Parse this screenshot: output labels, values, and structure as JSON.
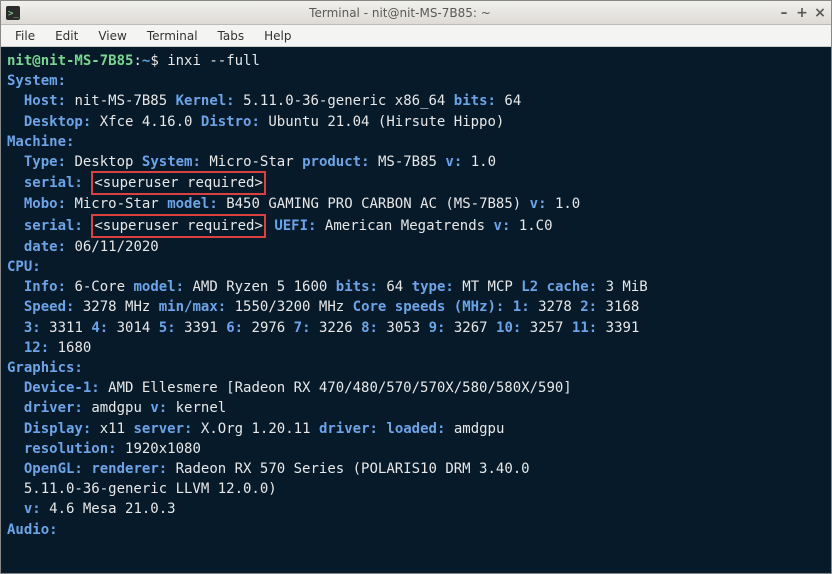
{
  "window": {
    "title": "Terminal - nit@nit-MS-7B85: ~"
  },
  "menubar": {
    "items": [
      "File",
      "Edit",
      "View",
      "Terminal",
      "Tabs",
      "Help"
    ]
  },
  "prompt": {
    "user_host": "nit@nit-MS-7B85",
    "sep": ":",
    "path": "~",
    "sign": "$"
  },
  "command": "inxi --full",
  "sections": {
    "system": {
      "header": "System:",
      "host_key": "Host:",
      "host": "nit-MS-7B85",
      "kernel_key": "Kernel:",
      "kernel": "5.11.0-36-generic x86_64",
      "bits_key": "bits:",
      "bits": "64",
      "desktop_key": "Desktop:",
      "desktop": "Xfce 4.16.0",
      "distro_key": "Distro:",
      "distro": "Ubuntu 21.04 (Hirsute Hippo)"
    },
    "machine": {
      "header": "Machine:",
      "type_key": "Type:",
      "type": "Desktop",
      "system_key": "System:",
      "system": "Micro-Star",
      "product_key": "product:",
      "product": "MS-7B85",
      "v_key": "v:",
      "v": "1.0",
      "serial_key1": "serial:",
      "serial1": "<superuser required>",
      "mobo_key": "Mobo:",
      "mobo": "Micro-Star",
      "model_key": "model:",
      "model": "B450 GAMING PRO CARBON AC (MS-7B85)",
      "mobo_v_key": "v:",
      "mobo_v": "1.0",
      "serial_key2": "serial:",
      "serial2": "<superuser required>",
      "uefi_key": "UEFI:",
      "uefi": "American Megatrends",
      "uefi_v_key": "v:",
      "uefi_v": "1.C0",
      "date_key": "date:",
      "date": "06/11/2020"
    },
    "cpu": {
      "header": "CPU:",
      "info_key": "Info:",
      "info": "6-Core",
      "model_key": "model:",
      "model": "AMD Ryzen 5 1600",
      "bits_key": "bits:",
      "bits": "64",
      "type_key": "type:",
      "type": "MT MCP",
      "l2_key": "L2 cache:",
      "l2": "3 MiB",
      "speed_key": "Speed:",
      "speed": "3278 MHz",
      "minmax_key": "min/max:",
      "minmax": "1550/3200 MHz",
      "cores_key": "Core speeds (MHz):",
      "c1k": "1:",
      "c1": "3278",
      "c2k": "2:",
      "c2": "3168",
      "c3k": "3:",
      "c3": "3311",
      "c4k": "4:",
      "c4": "3014",
      "c5k": "5:",
      "c5": "3391",
      "c6k": "6:",
      "c6": "2976",
      "c7k": "7:",
      "c7": "3226",
      "c8k": "8:",
      "c8": "3053",
      "c9k": "9:",
      "c9": "3267",
      "c10k": "10:",
      "c10": "3257",
      "c11k": "11:",
      "c11": "3391",
      "c12k": "12:",
      "c12": "1680"
    },
    "graphics": {
      "header": "Graphics:",
      "device1_key": "Device-1:",
      "device1": "AMD Ellesmere [Radeon RX 470/480/570/570X/580/580X/590]",
      "driver_key": "driver:",
      "driver": "amdgpu",
      "drv_v_key": "v:",
      "drv_v": "kernel",
      "display_key": "Display:",
      "display": "x11",
      "server_key": "server:",
      "server": "X.Org 1.20.11",
      "driver2_key": "driver:",
      "loaded_key": "loaded:",
      "loaded": "amdgpu",
      "res_key": "resolution:",
      "res": "1920x1080",
      "opengl_key": "OpenGL:",
      "renderer_key": "renderer:",
      "renderer": "Radeon RX 570 Series (POLARIS10 DRM 3.40.0",
      "renderer2": "5.11.0-36-generic LLVM 12.0.0)",
      "gl_v_key": "v:",
      "gl_v": "4.6 Mesa 21.0.3"
    },
    "audio": {
      "header": "Audio:"
    }
  }
}
